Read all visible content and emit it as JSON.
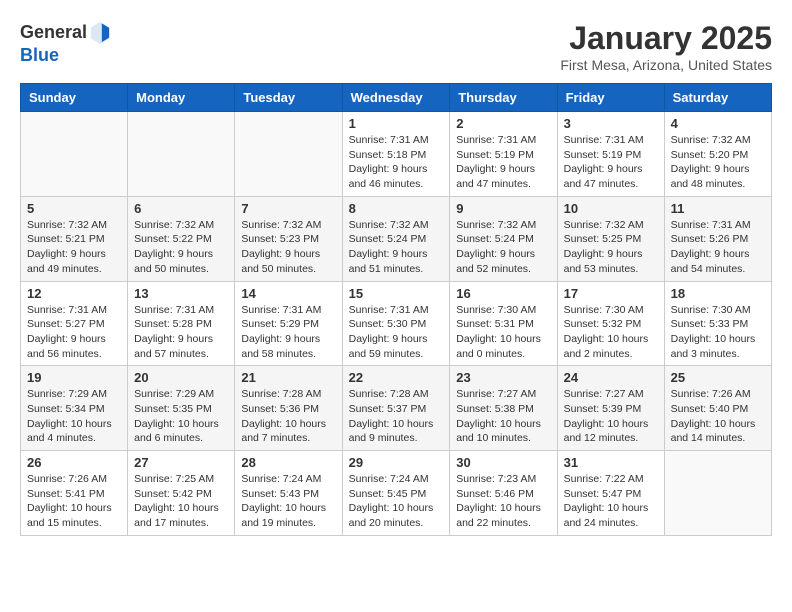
{
  "header": {
    "logo_line1": "General",
    "logo_line2": "Blue",
    "title": "January 2025",
    "subtitle": "First Mesa, Arizona, United States"
  },
  "weekdays": [
    "Sunday",
    "Monday",
    "Tuesday",
    "Wednesday",
    "Thursday",
    "Friday",
    "Saturday"
  ],
  "weeks": [
    [
      {
        "day": "",
        "info": ""
      },
      {
        "day": "",
        "info": ""
      },
      {
        "day": "",
        "info": ""
      },
      {
        "day": "1",
        "info": "Sunrise: 7:31 AM\nSunset: 5:18 PM\nDaylight: 9 hours and 46 minutes."
      },
      {
        "day": "2",
        "info": "Sunrise: 7:31 AM\nSunset: 5:19 PM\nDaylight: 9 hours and 47 minutes."
      },
      {
        "day": "3",
        "info": "Sunrise: 7:31 AM\nSunset: 5:19 PM\nDaylight: 9 hours and 47 minutes."
      },
      {
        "day": "4",
        "info": "Sunrise: 7:32 AM\nSunset: 5:20 PM\nDaylight: 9 hours and 48 minutes."
      }
    ],
    [
      {
        "day": "5",
        "info": "Sunrise: 7:32 AM\nSunset: 5:21 PM\nDaylight: 9 hours and 49 minutes."
      },
      {
        "day": "6",
        "info": "Sunrise: 7:32 AM\nSunset: 5:22 PM\nDaylight: 9 hours and 50 minutes."
      },
      {
        "day": "7",
        "info": "Sunrise: 7:32 AM\nSunset: 5:23 PM\nDaylight: 9 hours and 50 minutes."
      },
      {
        "day": "8",
        "info": "Sunrise: 7:32 AM\nSunset: 5:24 PM\nDaylight: 9 hours and 51 minutes."
      },
      {
        "day": "9",
        "info": "Sunrise: 7:32 AM\nSunset: 5:24 PM\nDaylight: 9 hours and 52 minutes."
      },
      {
        "day": "10",
        "info": "Sunrise: 7:32 AM\nSunset: 5:25 PM\nDaylight: 9 hours and 53 minutes."
      },
      {
        "day": "11",
        "info": "Sunrise: 7:31 AM\nSunset: 5:26 PM\nDaylight: 9 hours and 54 minutes."
      }
    ],
    [
      {
        "day": "12",
        "info": "Sunrise: 7:31 AM\nSunset: 5:27 PM\nDaylight: 9 hours and 56 minutes."
      },
      {
        "day": "13",
        "info": "Sunrise: 7:31 AM\nSunset: 5:28 PM\nDaylight: 9 hours and 57 minutes."
      },
      {
        "day": "14",
        "info": "Sunrise: 7:31 AM\nSunset: 5:29 PM\nDaylight: 9 hours and 58 minutes."
      },
      {
        "day": "15",
        "info": "Sunrise: 7:31 AM\nSunset: 5:30 PM\nDaylight: 9 hours and 59 minutes."
      },
      {
        "day": "16",
        "info": "Sunrise: 7:30 AM\nSunset: 5:31 PM\nDaylight: 10 hours and 0 minutes."
      },
      {
        "day": "17",
        "info": "Sunrise: 7:30 AM\nSunset: 5:32 PM\nDaylight: 10 hours and 2 minutes."
      },
      {
        "day": "18",
        "info": "Sunrise: 7:30 AM\nSunset: 5:33 PM\nDaylight: 10 hours and 3 minutes."
      }
    ],
    [
      {
        "day": "19",
        "info": "Sunrise: 7:29 AM\nSunset: 5:34 PM\nDaylight: 10 hours and 4 minutes."
      },
      {
        "day": "20",
        "info": "Sunrise: 7:29 AM\nSunset: 5:35 PM\nDaylight: 10 hours and 6 minutes."
      },
      {
        "day": "21",
        "info": "Sunrise: 7:28 AM\nSunset: 5:36 PM\nDaylight: 10 hours and 7 minutes."
      },
      {
        "day": "22",
        "info": "Sunrise: 7:28 AM\nSunset: 5:37 PM\nDaylight: 10 hours and 9 minutes."
      },
      {
        "day": "23",
        "info": "Sunrise: 7:27 AM\nSunset: 5:38 PM\nDaylight: 10 hours and 10 minutes."
      },
      {
        "day": "24",
        "info": "Sunrise: 7:27 AM\nSunset: 5:39 PM\nDaylight: 10 hours and 12 minutes."
      },
      {
        "day": "25",
        "info": "Sunrise: 7:26 AM\nSunset: 5:40 PM\nDaylight: 10 hours and 14 minutes."
      }
    ],
    [
      {
        "day": "26",
        "info": "Sunrise: 7:26 AM\nSunset: 5:41 PM\nDaylight: 10 hours and 15 minutes."
      },
      {
        "day": "27",
        "info": "Sunrise: 7:25 AM\nSunset: 5:42 PM\nDaylight: 10 hours and 17 minutes."
      },
      {
        "day": "28",
        "info": "Sunrise: 7:24 AM\nSunset: 5:43 PM\nDaylight: 10 hours and 19 minutes."
      },
      {
        "day": "29",
        "info": "Sunrise: 7:24 AM\nSunset: 5:45 PM\nDaylight: 10 hours and 20 minutes."
      },
      {
        "day": "30",
        "info": "Sunrise: 7:23 AM\nSunset: 5:46 PM\nDaylight: 10 hours and 22 minutes."
      },
      {
        "day": "31",
        "info": "Sunrise: 7:22 AM\nSunset: 5:47 PM\nDaylight: 10 hours and 24 minutes."
      },
      {
        "day": "",
        "info": ""
      }
    ]
  ]
}
